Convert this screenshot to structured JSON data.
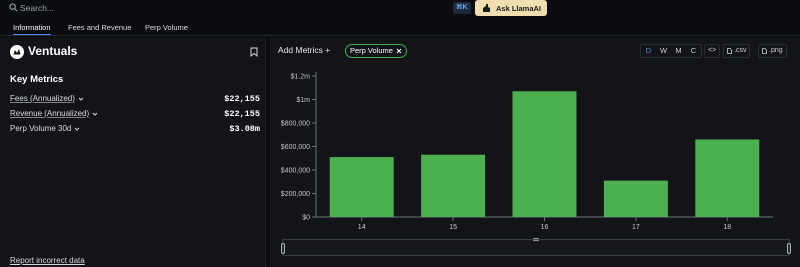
{
  "search": {
    "placeholder": "Search...",
    "shortcut": "⌘K"
  },
  "ask_button": {
    "label": "Ask LlamaAI"
  },
  "tabs": [
    {
      "label": "Information"
    },
    {
      "label": "Fees and Revenue"
    },
    {
      "label": "Perp Volume"
    }
  ],
  "protocol": {
    "name": "Ventuals"
  },
  "key_metrics": {
    "title": "Key Metrics",
    "rows": [
      {
        "label": "Fees (Annualized)",
        "value": "$22,155"
      },
      {
        "label": "Revenue (Annualized)",
        "value": "$22,155"
      },
      {
        "label": "Perp Volume 30d",
        "value": "$3.08m"
      }
    ]
  },
  "report_link": "Report incorrect data",
  "chart_controls": {
    "add_metrics": "Add Metrics",
    "chip_label": "Perp Volume",
    "periods": [
      "D",
      "W",
      "M",
      "C"
    ],
    "active_period": "D",
    "embed_label": "<>",
    "csv_label": ".csv",
    "png_label": ".png"
  },
  "colors": {
    "bar": "#4caf50",
    "accent": "#4a8cff",
    "chip_border": "#3fae4c"
  },
  "chart_data": {
    "type": "bar",
    "categories": [
      "14",
      "15",
      "16",
      "17",
      "18"
    ],
    "series": [
      {
        "values": [
          510000,
          530000,
          1070000,
          310000,
          660000
        ]
      }
    ],
    "yticks": [
      0,
      200000,
      400000,
      600000,
      800000,
      1000000,
      1200000
    ],
    "ytick_labels": [
      "$0",
      "$200,000",
      "$400,000",
      "$600,000",
      "$800,000",
      "$1m",
      "$1.2m"
    ],
    "ylim": [
      0,
      1200000
    ],
    "grid": false
  }
}
